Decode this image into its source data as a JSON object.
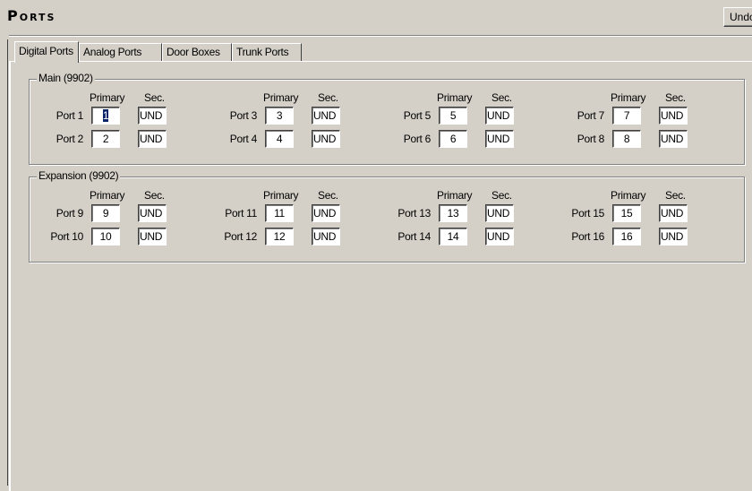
{
  "title": "Ports",
  "undo_label": "Undo",
  "tabs": [
    "Digital Ports",
    "Analog Ports",
    "Door Boxes",
    "Trunk Ports"
  ],
  "active_tab": "Digital Ports",
  "column_headers": {
    "primary": "Primary",
    "sec": "Sec."
  },
  "groups": [
    {
      "label": "Main (9902)",
      "ports": [
        {
          "label": "Port 1",
          "primary": "1",
          "sec": "UND",
          "selected": true
        },
        {
          "label": "Port 2",
          "primary": "2",
          "sec": "UND"
        },
        {
          "label": "Port 3",
          "primary": "3",
          "sec": "UND"
        },
        {
          "label": "Port 4",
          "primary": "4",
          "sec": "UND"
        },
        {
          "label": "Port 5",
          "primary": "5",
          "sec": "UND"
        },
        {
          "label": "Port 6",
          "primary": "6",
          "sec": "UND"
        },
        {
          "label": "Port 7",
          "primary": "7",
          "sec": "UND"
        },
        {
          "label": "Port 8",
          "primary": "8",
          "sec": "UND"
        }
      ]
    },
    {
      "label": "Expansion (9902)",
      "ports": [
        {
          "label": "Port 9",
          "primary": "9",
          "sec": "UND"
        },
        {
          "label": "Port 10",
          "primary": "10",
          "sec": "UND"
        },
        {
          "label": "Port 11",
          "primary": "11",
          "sec": "UND"
        },
        {
          "label": "Port 12",
          "primary": "12",
          "sec": "UND"
        },
        {
          "label": "Port 13",
          "primary": "13",
          "sec": "UND"
        },
        {
          "label": "Port 14",
          "primary": "14",
          "sec": "UND"
        },
        {
          "label": "Port 15",
          "primary": "15",
          "sec": "UND"
        },
        {
          "label": "Port 16",
          "primary": "16",
          "sec": "UND"
        }
      ]
    }
  ]
}
